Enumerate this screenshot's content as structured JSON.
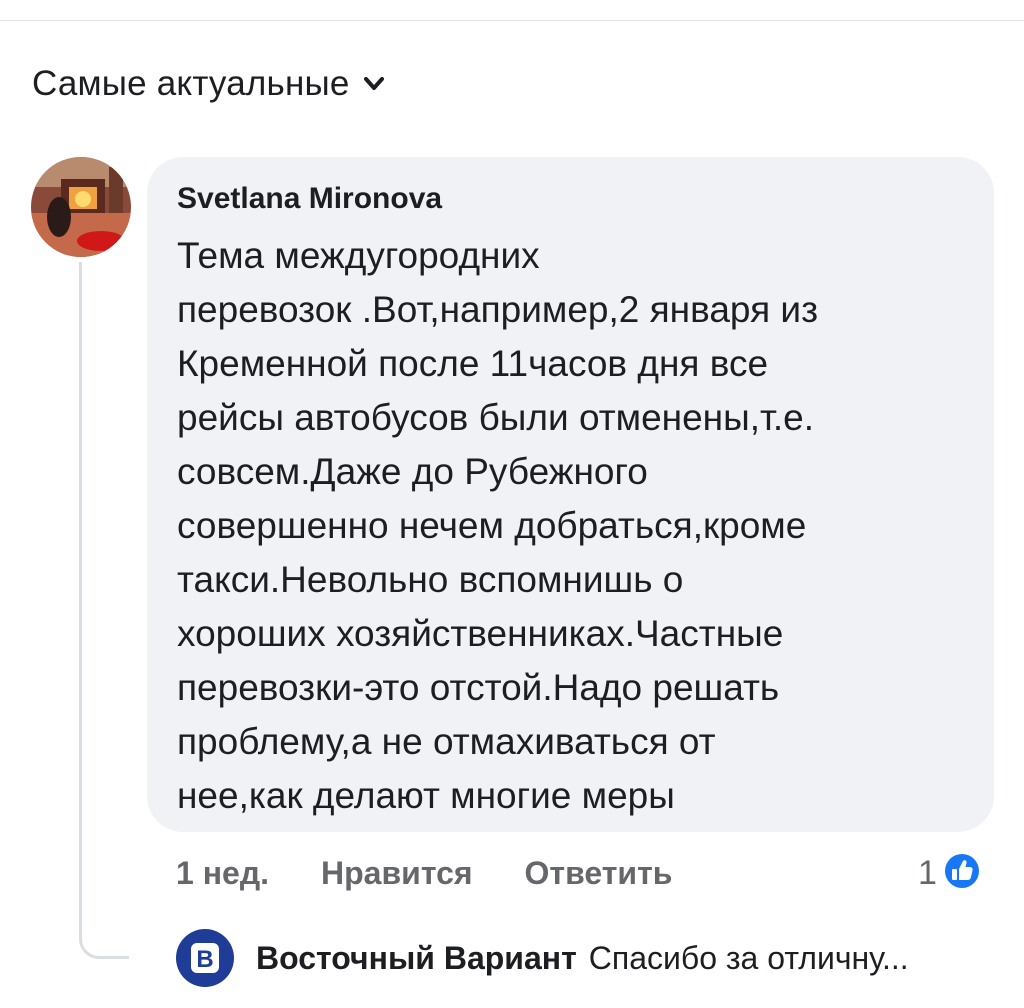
{
  "sort": {
    "label": "Самые актуальные",
    "icon": "chevron-down-icon"
  },
  "comment": {
    "author": "Svetlana Mironova",
    "text_lines": [
      "Тема междугородних",
      "перевозок .Вот,например,2 января из",
      "Кременной после 11часов дня все",
      "рейсы автобусов были отменены,т.е.",
      "совсем.Даже до Рубежного",
      "совершенно нечем добраться,кроме",
      "такси.Невольно вспомнишь о",
      "хороших хозяйственниках.Частные",
      "перевозки-это отстой.Надо решать",
      "проблему,а не отмахиваться от",
      "нее,как делают многие меры"
    ],
    "timestamp": "1 нед.",
    "like_label": "Нравится",
    "reply_label": "Ответить",
    "reaction_count": "1",
    "reaction_icon": "like-icon"
  },
  "reply": {
    "avatar_letter": "B",
    "author": "Восточный Вариант",
    "preview": "Спасибо за отличну..."
  },
  "colors": {
    "bubble_bg": "#f0f2f5",
    "secondary_text": "#65676b",
    "primary_text": "#1c1e21",
    "like_blue": "#1877f2",
    "reply_avatar_bg": "#1f3c96"
  }
}
